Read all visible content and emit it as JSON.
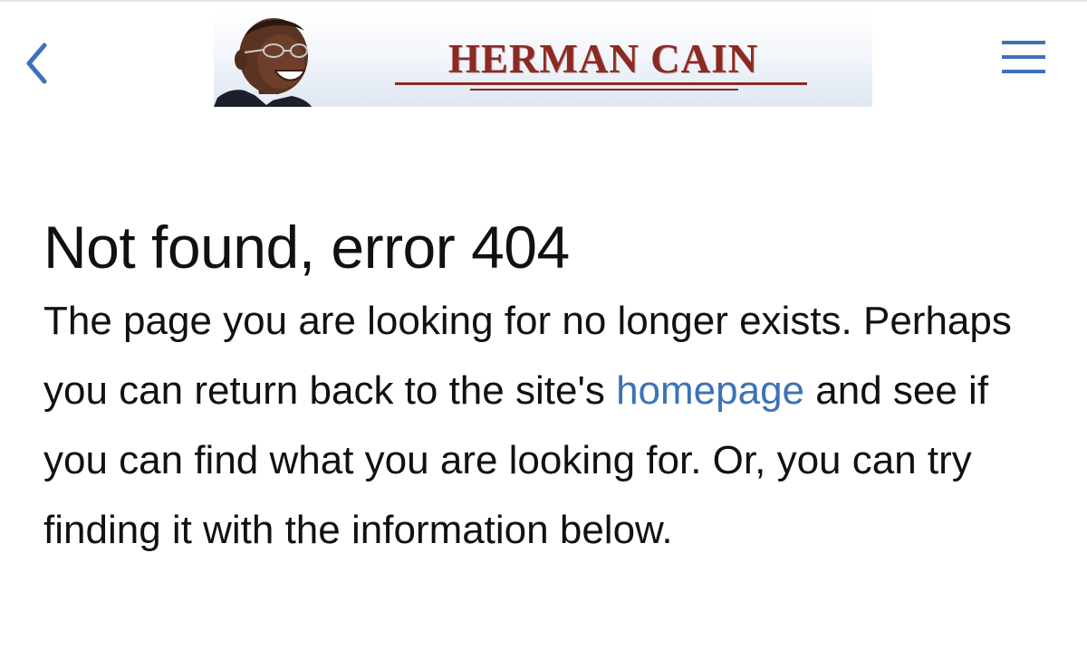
{
  "header": {
    "back_icon": "chevron-left-icon",
    "menu_icon": "hamburger-menu-icon",
    "accent_color": "#3b73b9",
    "banner": {
      "title": "HERMAN CAIN",
      "title_color": "#8c2a22"
    }
  },
  "main": {
    "heading": "Not found, error 404",
    "paragraph": {
      "part1": "The page you are looking for no longer exists. Perhaps you can return back to the site's ",
      "link_text": "homepage",
      "part2": " and see if you can find what you are looking for. Or, you can try finding it with the information below."
    }
  }
}
